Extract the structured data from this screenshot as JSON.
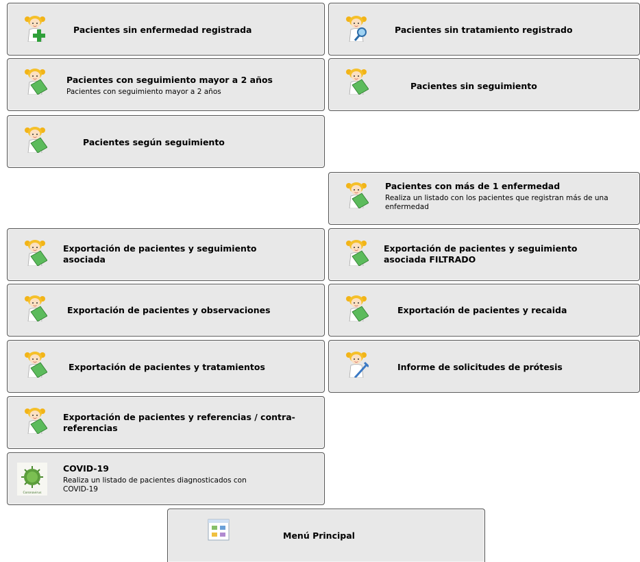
{
  "buttons": [
    {
      "label": "Pacientes sin enfermedad registrada",
      "icon": "patient-add-icon"
    },
    {
      "label": "Pacientes sin tratamiento registrado",
      "icon": "patient-search-icon"
    },
    {
      "label": "Pacientes con seguimiento mayor a 2 años",
      "sub": "Pacientes con seguimiento mayor a 2 años",
      "icon": "patient-notebook-icon"
    },
    {
      "label": "Pacientes sin seguimiento",
      "icon": "patient-notebook-icon"
    },
    {
      "label": "Pacientes según seguimiento",
      "icon": "patient-notebook-icon"
    },
    {
      "label": "Pacientes con más de 1 enfermedad",
      "sub": "Realiza un listado con los pacientes que registran más de una enfermedad",
      "icon": "patient-notebook-icon"
    },
    {
      "label": "Exportación de pacientes y seguimiento asociada",
      "icon": "patient-notebook-icon"
    },
    {
      "label": "Exportación de pacientes y seguimiento asociada FILTRADO",
      "icon": "patient-notebook-icon"
    },
    {
      "label": "Exportación de pacientes y observaciones",
      "icon": "patient-notebook-icon"
    },
    {
      "label": "Exportación de pacientes y recaida",
      "icon": "patient-notebook-icon"
    },
    {
      "label": "Exportación de pacientes y tratamientos",
      "icon": "patient-notebook-icon"
    },
    {
      "label": "Informe de solicitudes de prótesis",
      "icon": "patient-crutch-icon"
    },
    {
      "label": "Exportación de pacientes y referencias / contra-referencias",
      "icon": "patient-notebook-icon"
    },
    {
      "label": "COVID-19",
      "sub": "Realiza un listado de pacientes diagnosticados con COVID-19",
      "icon": "coronavirus-icon",
      "icon_caption": "Coronavirus"
    },
    {
      "label": "Menú Principal",
      "icon": "main-menu-icon"
    }
  ]
}
